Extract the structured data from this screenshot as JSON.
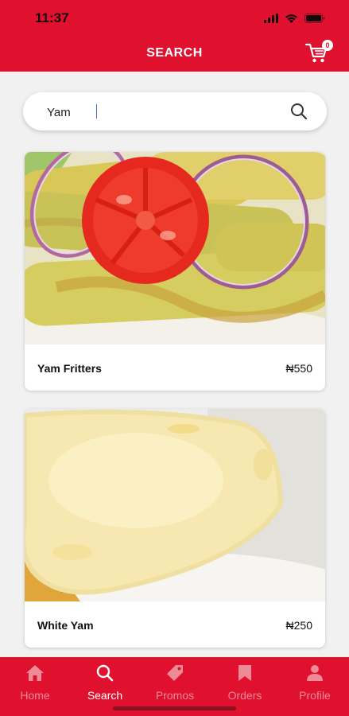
{
  "status_bar": {
    "time": "11:37"
  },
  "header": {
    "title": "SEARCH",
    "cart_count": "0"
  },
  "search": {
    "value": "Yam"
  },
  "results": [
    {
      "name": "Yam Fritters",
      "price": "₦550"
    },
    {
      "name": "White Yam",
      "price": "₦250"
    }
  ],
  "bottom_nav": {
    "items": [
      {
        "label": "Home",
        "icon": "home-icon"
      },
      {
        "label": "Search",
        "icon": "search-icon",
        "active": true
      },
      {
        "label": "Promos",
        "icon": "tag-icon"
      },
      {
        "label": "Orders",
        "icon": "bookmark-icon"
      },
      {
        "label": "Profile",
        "icon": "person-icon"
      }
    ]
  },
  "colors": {
    "brand": "#e0102f",
    "nav_inactive": "#f08a97"
  }
}
